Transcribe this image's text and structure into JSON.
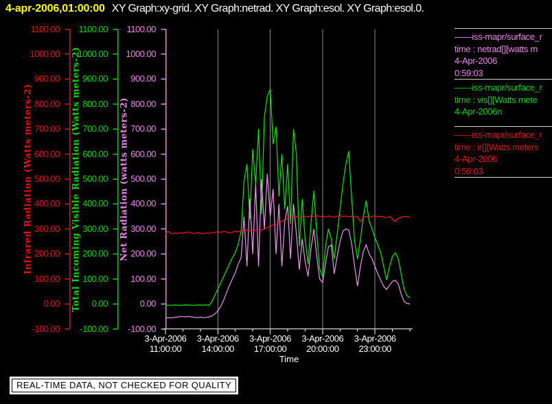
{
  "header": {
    "timestamp": "4-apr-2006,01:00:00",
    "title": "XY Graph:xy-grid.  XY Graph:netrad.  XY Graph:esol.  XY Graph:esol.0."
  },
  "footer": {
    "disclaimer": "REAL-TIME DATA, NOT CHECKED FOR QUALITY"
  },
  "legend": {
    "entries": [
      {
        "name": "netrad",
        "color": "#ee82ee",
        "lines": [
          "——iss-mapr/surface_r",
          "time : netrad[][watts m",
          "4-Apr-2006",
          "0:59:03"
        ]
      },
      {
        "name": "vis",
        "color": "#00d800",
        "lines": [
          "——iss-mapr/surface_r",
          "time : vis[][Watts mete",
          "4-Apr-2006n"
        ]
      },
      {
        "name": "ir",
        "color": "#e81010",
        "lines": [
          "——iss-mapr/surface_r",
          "time : ir[][Watts meters",
          "4-Apr-2006",
          "0:59:03"
        ]
      }
    ]
  },
  "chart_data": {
    "type": "line",
    "xlabel": "Time",
    "x_unit": "hours since 3-Apr-2006 00:00 (times past 24 are 4-Apr-2006)",
    "xlim": [
      11,
      25.15
    ],
    "ylim": [
      -100,
      1100
    ],
    "grid": "vertical-only",
    "grid_color": "#8f8f8f",
    "gridline_hours": [
      14,
      17,
      20,
      23
    ],
    "minor_tick_hours": [
      12,
      13,
      15,
      16,
      18,
      19,
      21,
      22,
      24,
      25
    ],
    "x_ticks": [
      {
        "hour": 11,
        "date": "3-Apr-2006",
        "time": "11:00:00"
      },
      {
        "hour": 14,
        "date": "3-Apr-2006",
        "time": "14:00:00"
      },
      {
        "hour": 17,
        "date": "3-Apr-2006",
        "time": "17:00:00"
      },
      {
        "hour": 20,
        "date": "3-Apr-2006",
        "time": "20:00:00"
      },
      {
        "hour": 23,
        "date": "3-Apr-2006",
        "time": "23:00:00"
      }
    ],
    "y_tick_labels": [
      "1100.00",
      "1000.00",
      "900.00",
      "800.00",
      "700.00",
      "600.00",
      "500.00",
      "400.00",
      "300.00",
      "200.00",
      "100.00",
      "0.00",
      "-100.00"
    ],
    "axes": [
      {
        "label": "Infrared Radiation (Watts meters-2)",
        "color": "#e81010"
      },
      {
        "label": "Total Incoming Visible Radiation (Watts meters-2)",
        "color": "#00d800"
      },
      {
        "label": "Net Radiation (watts meters-2)",
        "color": "#ee82ee"
      }
    ],
    "legend_position": "right-outside",
    "series": [
      {
        "name": "vis",
        "color": "#00f000",
        "t0": 11,
        "dt_minutes": 10,
        "values": [
          -5,
          -5,
          -6,
          -4,
          -5,
          -6,
          -5,
          -4,
          -5,
          -5,
          -6,
          -4,
          -5,
          -5,
          -4,
          -6,
          10,
          35,
          60,
          85,
          110,
          135,
          160,
          185,
          205,
          240,
          290,
          490,
          560,
          340,
          620,
          480,
          700,
          360,
          750,
          830,
          860,
          640,
          710,
          430,
          600,
          380,
          560,
          320,
          700,
          600,
          230,
          420,
          260,
          160,
          320,
          453,
          280,
          140,
          110,
          230,
          300,
          260,
          180,
          280,
          380,
          480,
          560,
          612,
          420,
          250,
          180,
          260,
          350,
          414,
          330,
          300,
          264,
          235,
          205,
          150,
          96,
          150,
          190,
          205,
          180,
          120,
          60,
          33,
          25
        ]
      },
      {
        "name": "netrad",
        "color": "#ee96ee",
        "t0": 11,
        "dt_minutes": 10,
        "values": [
          -57,
          -55,
          -56,
          -54,
          -53,
          -50,
          -51,
          -52,
          -50,
          -52,
          -54,
          -55,
          -53,
          -55,
          -54,
          -52,
          -48,
          -40,
          -28,
          -10,
          15,
          45,
          75,
          100,
          125,
          160,
          185,
          350,
          150,
          420,
          200,
          480,
          150,
          500,
          300,
          521,
          350,
          460,
          200,
          400,
          150,
          330,
          392,
          180,
          400,
          280,
          137,
          260,
          170,
          110,
          220,
          300,
          190,
          100,
          85,
          160,
          228,
          236,
          120,
          190,
          250,
          291,
          300,
          296,
          240,
          150,
          71,
          150,
          210,
          236,
          200,
          180,
          150,
          120,
          95,
          70,
          58,
          75,
          90,
          95,
          80,
          40,
          10,
          2,
          0
        ]
      },
      {
        "name": "ir",
        "color": "#ff1414",
        "t0": 11,
        "dt_minutes": 10,
        "values": [
          283,
          290,
          281,
          284,
          282,
          285,
          283,
          286,
          288,
          284,
          282,
          285,
          283,
          281,
          284,
          283,
          285,
          287,
          289,
          286,
          291,
          288,
          284,
          287,
          292,
          288,
          294,
          290,
          296,
          292,
          296,
          293,
          298,
          295,
          300,
          305,
          312,
          316,
          318,
          325,
          332,
          336,
          342,
          345,
          347,
          349,
          347,
          350,
          351,
          349,
          352,
          350,
          353,
          351,
          350,
          348,
          352,
          350,
          347,
          351,
          353,
          350,
          352,
          349,
          351,
          347,
          350,
          330,
          345,
          350,
          348,
          351,
          352,
          349,
          351,
          348,
          345,
          350,
          340,
          330,
          342,
          348,
          350,
          349,
          348
        ]
      }
    ]
  }
}
